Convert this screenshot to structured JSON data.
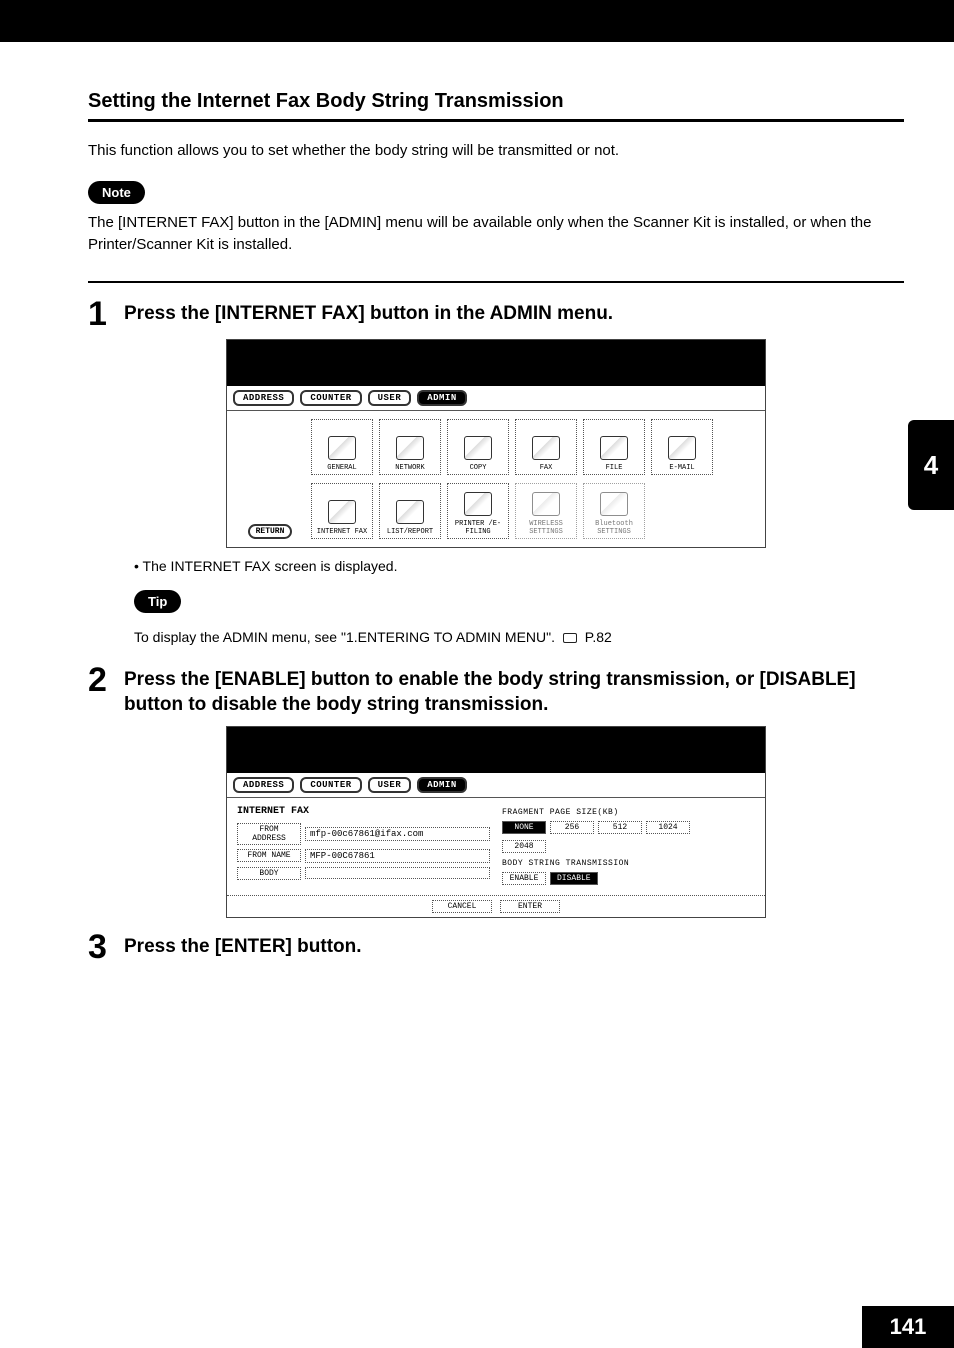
{
  "sidebar": {
    "chapter": "4"
  },
  "page_number": "141",
  "title": "Setting the Internet Fax Body String Transmission",
  "intro": "This function allows you to set whether the body string will be transmitted or not.",
  "note": {
    "label": "Note",
    "text": "The [INTERNET FAX] button in the [ADMIN] menu will be available only when the Scanner Kit is installed, or when the Printer/Scanner Kit is installed."
  },
  "steps": {
    "s1": {
      "num": "1",
      "text": "Press the [INTERNET FAX] button in the ADMIN menu.",
      "bullet": "•  The INTERNET FAX screen is displayed."
    },
    "tip": {
      "label": "Tip",
      "text_before": "To display the ADMIN menu, see \"1.ENTERING TO ADMIN MENU\".",
      "page_ref": "P.82"
    },
    "s2": {
      "num": "2",
      "text": "Press the [ENABLE] button to enable the body string transmission, or [DISABLE] button to disable the body string transmission."
    },
    "s3": {
      "num": "3",
      "text": "Press the [ENTER] button."
    }
  },
  "panel1": {
    "tabs": {
      "address": "ADDRESS",
      "counter": "COUNTER",
      "user": "USER",
      "admin": "ADMIN"
    },
    "return": "RETURN",
    "row1": {
      "general": "GENERAL",
      "network": "NETWORK",
      "copy": "COPY",
      "fax": "FAX",
      "file": "FILE",
      "email": "E-MAIL"
    },
    "row2": {
      "ifax": "INTERNET FAX",
      "list": "LIST/REPORT",
      "printer": "PRINTER\n/E-FILING",
      "wireless": "WIRELESS\nSETTINGS",
      "bluetooth": "Bluetooth\nSETTINGS"
    }
  },
  "panel2": {
    "tabs": {
      "address": "ADDRESS",
      "counter": "COUNTER",
      "user": "USER",
      "admin": "ADMIN"
    },
    "title": "INTERNET FAX",
    "frag_label": "FRAGMENT PAGE SIZE(KB)",
    "from_address_label": "FROM ADDRESS",
    "from_address_value": "mfp-00c67861@ifax.com",
    "from_name_label": "FROM NAME",
    "from_name_value": "MFP-00C67861",
    "body_label": "BODY",
    "body_value": "",
    "frag_opts": {
      "none": "NONE",
      "v256": "256",
      "v512": "512",
      "v1024": "1024",
      "v2048": "2048"
    },
    "body_trans_label": "BODY STRING TRANSMISSION",
    "enable": "ENABLE",
    "disable": "DISABLE",
    "cancel": "CANCEL",
    "enter": "ENTER"
  }
}
